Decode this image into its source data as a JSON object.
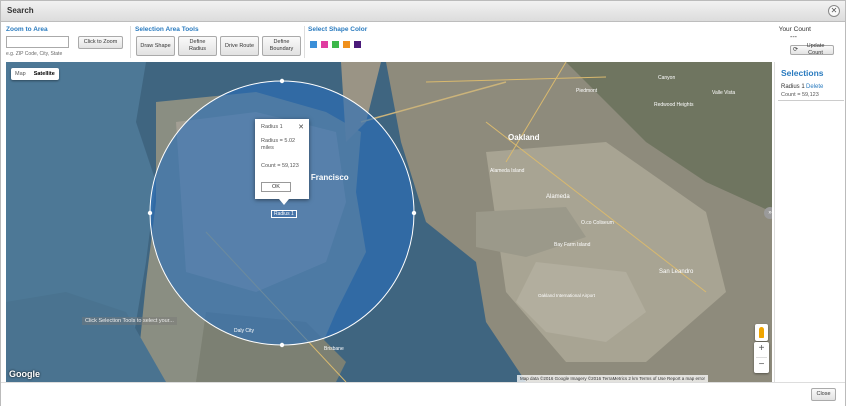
{
  "window": {
    "title": "Search"
  },
  "toolbar": {
    "zoom_label": "Zoom to Area",
    "zoom_input_placeholder": "",
    "zoom_hint": "e.g. ZIP Code, City, State",
    "zoom_button": "Click to Zoom",
    "selection_tools_label": "Selection Area Tools",
    "tools": [
      "Draw Shape",
      "Define Radius",
      "Drive Route",
      "Define Boundary"
    ],
    "shape_color_label": "Select Shape Color",
    "shape_colors": [
      "#3a8fd8",
      "#e03ca0",
      "#3cb84a",
      "#f0901c",
      "#4a1a7a"
    ],
    "your_count_label": "Your Count",
    "your_count_value": "---",
    "update_count_button": "Update Count"
  },
  "map": {
    "map_type_options": [
      "Map",
      "Satellite"
    ],
    "active_map_type": "Satellite",
    "popup": {
      "title": "Radius 1",
      "radius_text": "Radius = 5.02 miles",
      "count_text": "Count = 59,123",
      "ok_button": "OK"
    },
    "radius_tag": "Radius 1",
    "overlay_hint": "Click Selection Tools to select your...",
    "logo": "Google",
    "attribution": "Map data ©2016 Google Imagery ©2016 TerraMetrics   2 km   Terms of Use   Report a map error",
    "expand_icon": "chevron-right-icon",
    "place_labels": [
      "Oakland",
      "Alameda Island",
      "Alameda",
      "Canyon",
      "Redwood Heights",
      "Valle Vista",
      "Piedmont",
      "O.co Coliseum",
      "Oakland International Airport",
      "San Leandro",
      "Bay Farm Island",
      "Brisbane",
      "Daly City",
      "San Francisco"
    ]
  },
  "selections": {
    "title": "Selections",
    "items": [
      {
        "name": "Radius 1",
        "action": "Delete",
        "count": "Count = 59,123"
      }
    ]
  },
  "footer": {
    "close_button": "Close"
  }
}
